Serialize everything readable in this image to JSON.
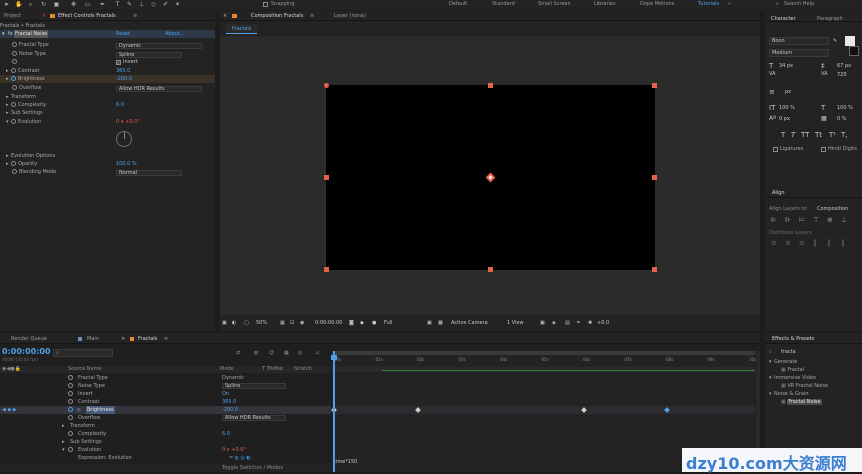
{
  "topbar": {
    "snapping_label": "Snapping",
    "workspaces": [
      "Default",
      "Standard",
      "Small Screen",
      "Libraries",
      "Dope Motions",
      "Tutorials"
    ],
    "active_workspace": "Tutorials",
    "search_placeholder": "Search Help"
  },
  "effect_controls": {
    "project_tab": "Project",
    "tab_label": "Effect Controls Fractals",
    "breadcrumb": "Fractals • Fractals",
    "effect_name": "Fractal Noise",
    "reset": "Reset",
    "about": "About...",
    "properties": {
      "fractal_type": {
        "label": "Fractal Type",
        "value": "Dynamic"
      },
      "noise_type": {
        "label": "Noise Type",
        "value": "Spline"
      },
      "invert": {
        "label": "Invert"
      },
      "contrast": {
        "label": "Contrast",
        "value": "365.0"
      },
      "brightness": {
        "label": "Brightness",
        "value": "-200.0"
      },
      "overflow": {
        "label": "Overflow",
        "value": "Allow HDR Results"
      },
      "transform": {
        "label": "Transform"
      },
      "complexity": {
        "label": "Complexity",
        "value": "6.0"
      },
      "sub_settings": {
        "label": "Sub Settings"
      },
      "evolution": {
        "label": "Evolution",
        "value": "0 x +0.0°"
      },
      "evolution_options": {
        "label": "Evolution Options"
      },
      "opacity": {
        "label": "Opacity",
        "value": "100.0 %"
      },
      "blending_mode": {
        "label": "Blending Mode",
        "value": "Normal"
      }
    }
  },
  "composition": {
    "tab_label": "Composition Fractals",
    "layer_tab": "Layer (none)",
    "sub_tab": "Fractals",
    "bottom": {
      "zoom": "50%",
      "timecode": "0:00:00:00",
      "resolution": "Full",
      "camera": "Active Camera",
      "view": "1 View",
      "exposure": "+0.0"
    }
  },
  "character": {
    "tab": "Character",
    "paragraph_tab": "Paragraph",
    "font": "Boon",
    "weight": "Medium",
    "size": "34 px",
    "leading": "67 px",
    "tracking": "720",
    "stroke": "px",
    "scale_v": "100 %",
    "scale_h": "100 %",
    "baseline": "0 px",
    "tsume": "0 %",
    "style_buttons": [
      "T",
      "T",
      "TT",
      "Tt",
      "T¹",
      "T,"
    ],
    "ligatures": "Ligatures",
    "hindi_digits": "Hindi Digits"
  },
  "align": {
    "tab": "Align",
    "align_to_label": "Align Layers to:",
    "align_to_value": "Composition",
    "distribute_label": "Distribute Layers"
  },
  "timeline": {
    "tabs": [
      "Render Queue",
      "Main",
      "Fractals"
    ],
    "active_tab": "Fractals",
    "timecode": "0:00:00:00",
    "timecode_sub": "00000 (30.00 fps)",
    "col_source": "Source Name",
    "col_mode": "Mode",
    "col_trkmat": "T TrkMat",
    "col_stretch": "Stretch",
    "layers": [
      {
        "name": "Fractal Type",
        "value": "Dynamic"
      },
      {
        "name": "Noise Type",
        "value": "Spline"
      },
      {
        "name": "Invert",
        "value": "On"
      },
      {
        "name": "Contrast",
        "value": "365.0"
      },
      {
        "name": "Brightness",
        "value": "-200.0"
      },
      {
        "name": "Overflow",
        "value": "Allow HDR Results"
      },
      {
        "name": "Transform",
        "value": ""
      },
      {
        "name": "Complexity",
        "value": "6.0"
      },
      {
        "name": "Sub Settings",
        "value": ""
      },
      {
        "name": "Evolution",
        "value": "0 x +0.0°"
      },
      {
        "name": "Expression: Evolution",
        "value": ""
      }
    ],
    "expression_text": "time*150",
    "toggle_label": "Toggle Switches / Modes",
    "ruler": [
      "00s",
      "01s",
      "02s",
      "03s",
      "04s",
      "05s",
      "06s",
      "07s",
      "08s",
      "09s",
      "10s"
    ]
  },
  "effects_presets": {
    "tab": "Effects & Presets",
    "search_value": "fracta",
    "tree": [
      {
        "label": "Generate",
        "level": 0
      },
      {
        "label": "Fractal",
        "level": 1
      },
      {
        "label": "Immersive Video",
        "level": 0
      },
      {
        "label": "VR Fractal Noise",
        "level": 1
      },
      {
        "label": "Noise & Grain",
        "level": 0
      },
      {
        "label": "Fractal Noise",
        "level": 1,
        "selected": true
      }
    ]
  },
  "watermark": "dzy10.com大资源网",
  "colors": {
    "accent": "#4ea0e8",
    "keyframe": "#d0d0d0",
    "handle": "#e8604a",
    "watermark": "#3a7fd0"
  }
}
